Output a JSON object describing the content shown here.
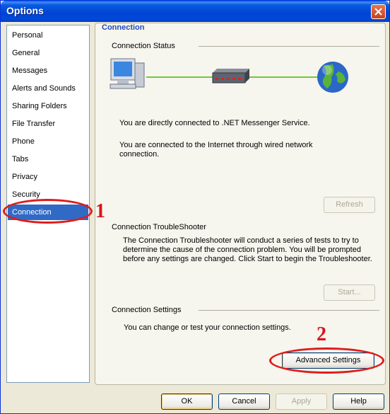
{
  "window": {
    "title": "Options"
  },
  "sidebar": {
    "items": [
      {
        "label": "Personal"
      },
      {
        "label": "General"
      },
      {
        "label": "Messages"
      },
      {
        "label": "Alerts and Sounds"
      },
      {
        "label": "Sharing Folders"
      },
      {
        "label": "File Transfer"
      },
      {
        "label": "Phone"
      },
      {
        "label": "Tabs"
      },
      {
        "label": "Privacy"
      },
      {
        "label": "Security"
      },
      {
        "label": "Connection",
        "selected": true
      }
    ]
  },
  "content": {
    "title": "Connection",
    "status": {
      "header": "Connection Status",
      "line1": "You are directly connected to .NET Messenger Service.",
      "line2": "You are connected to the Internet through wired network connection.",
      "refresh_label": "Refresh"
    },
    "troubleshooter": {
      "header": "Connection TroubleShooter",
      "description": "The Connection Troubleshooter will conduct a series of tests to try to determine the cause of the connection problem. You will be prompted before any settings are changed. Click Start to begin the Troubleshooter.",
      "start_label": "Start..."
    },
    "settings": {
      "header": "Connection Settings",
      "description": "You can change or test your connection settings.",
      "advanced_label": "Advanced Settings"
    }
  },
  "footer": {
    "ok_label": "OK",
    "cancel_label": "Cancel",
    "apply_label": "Apply",
    "help_label": "Help"
  },
  "annotations": {
    "marker1": "1",
    "marker2": "2"
  },
  "colors": {
    "selection": "#316ac5",
    "annotation_red": "#e01b1b",
    "title_blue": "#1f4bbd"
  }
}
